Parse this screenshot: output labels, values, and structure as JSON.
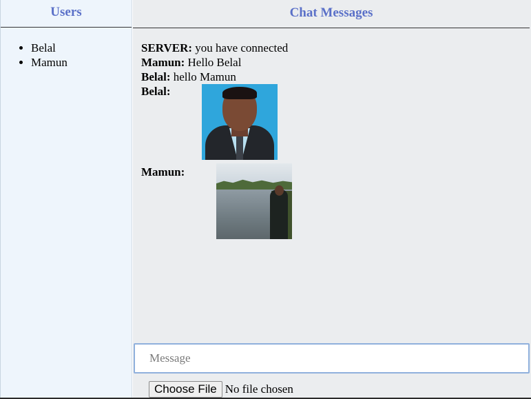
{
  "sidebar": {
    "title": "Users",
    "users": [
      "Belal",
      "Mamun"
    ]
  },
  "chat": {
    "title": "Chat Messages",
    "messages": [
      {
        "sender": "SERVER:",
        "text": "you have connected"
      },
      {
        "sender": "Mamun:",
        "text": "Hello Belal"
      },
      {
        "sender": "Belal:",
        "text": "hello Mamun"
      },
      {
        "sender": "Belal:",
        "image": "portrait-photo"
      },
      {
        "sender": "Mamun:",
        "image": "lake-photo"
      }
    ]
  },
  "composer": {
    "placeholder": "Message",
    "file_button_label": "Choose File",
    "file_status": "No file chosen"
  },
  "colors": {
    "title_color": "#5a70c8",
    "sidebar_bg": "#eef5fc",
    "main_bg": "#ebedef",
    "input_border": "#8fb0dc"
  }
}
